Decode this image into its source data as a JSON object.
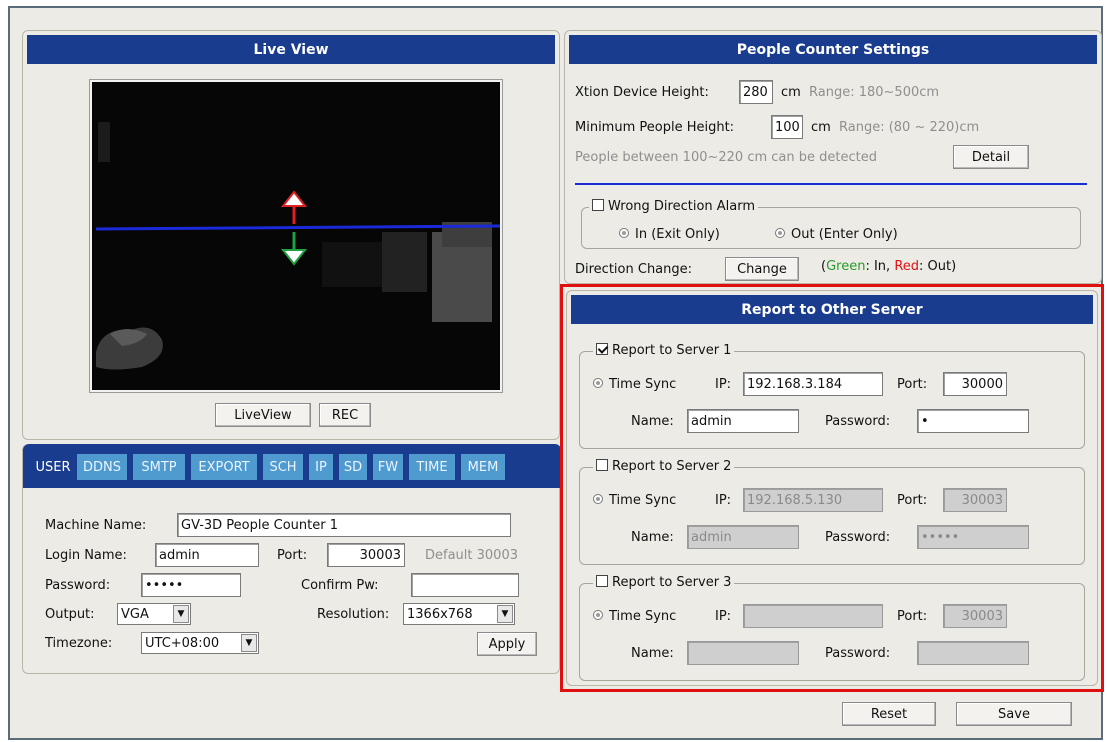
{
  "live_view": {
    "title": "Live View",
    "liveview_button": "LiveView",
    "rec_button": "REC"
  },
  "tabs": [
    "USER",
    "DDNS",
    "SMTP",
    "EXPORT",
    "SCH",
    "IP",
    "SD",
    "FW",
    "TIME",
    "MEM"
  ],
  "user_form": {
    "machine_name_label": "Machine Name:",
    "machine_name": "GV-3D People Counter 1",
    "login_name_label": "Login Name:",
    "login_name": "admin",
    "port_label": "Port:",
    "port": "30003",
    "port_default": "Default 30003",
    "password_label": "Password:",
    "password": "•••••",
    "confirm_label": "Confirm Pw:",
    "confirm": "",
    "output_label": "Output:",
    "output": "VGA",
    "resolution_label": "Resolution:",
    "resolution": "1366x768",
    "timezone_label": "Timezone:",
    "timezone": "UTC+08:00",
    "apply_button": "Apply"
  },
  "settings": {
    "title": "People Counter Settings",
    "device_height_label": "Xtion Device Height:",
    "device_height": "280",
    "device_height_unit": "cm",
    "device_height_range": "Range: 180~500cm",
    "min_height_label": "Minimum People Height:",
    "min_height": "100",
    "min_height_unit": "cm",
    "min_height_range": "Range: (80 ~ 220)cm",
    "detect_note": "People between 100~220 cm can be detected",
    "detail_button": "Detail",
    "wrong_direction_label": "Wrong Direction Alarm",
    "in_option": "In (Exit Only)",
    "out_option": "Out (Enter Only)",
    "direction_change_label": "Direction Change:",
    "change_button": "Change",
    "legend_open": "(",
    "legend_green": "Green",
    "legend_in": ": In, ",
    "legend_red": "Red",
    "legend_out": ": Out)"
  },
  "report": {
    "title": "Report to Other Server",
    "servers": [
      {
        "label": "Report to Server 1",
        "time_sync": "Time Sync",
        "ip_label": "IP:",
        "ip": "192.168.3.184",
        "port_label": "Port:",
        "port": "30000",
        "name_label": "Name:",
        "name": "admin",
        "password_label": "Password:",
        "password": "•"
      },
      {
        "label": "Report to Server 2",
        "time_sync": "Time Sync",
        "ip_label": "IP:",
        "ip": "192.168.5.130",
        "port_label": "Port:",
        "port": "30003",
        "name_label": "Name:",
        "name": "admin",
        "password_label": "Password:",
        "password": "•••••"
      },
      {
        "label": "Report to Server 3",
        "time_sync": "Time Sync",
        "ip_label": "IP:",
        "ip": "",
        "port_label": "Port:",
        "port": "30003",
        "name_label": "Name:",
        "name": "",
        "password_label": "Password:",
        "password": ""
      }
    ]
  },
  "footer": {
    "reset_button": "Reset",
    "save_button": "Save"
  },
  "colors": {
    "header_blue": "#1a3c8f",
    "tab_blue": "#4f9bd0",
    "highlight_red": "#e01010",
    "line_blue": "#1a2ad8"
  }
}
